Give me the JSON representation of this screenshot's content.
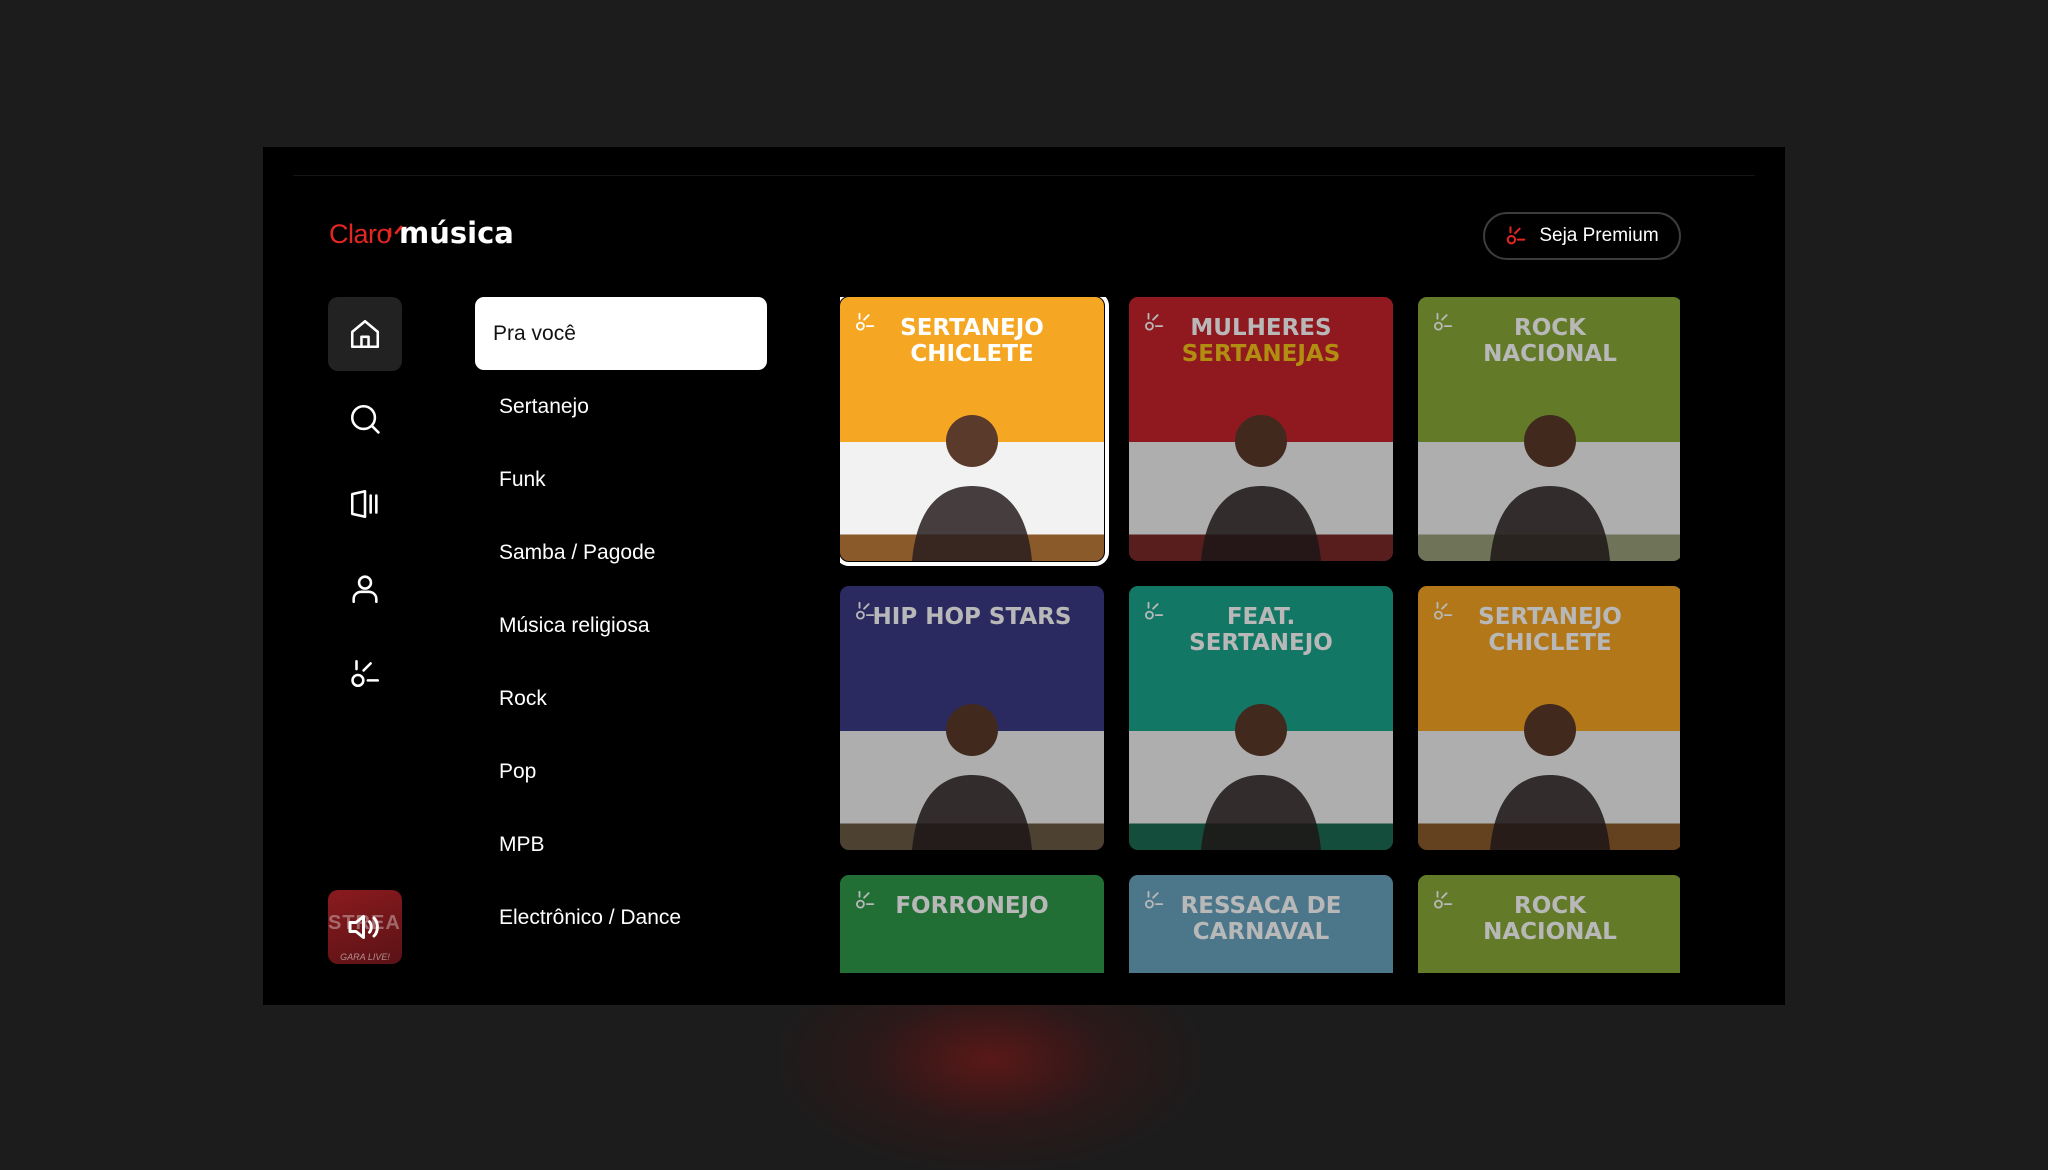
{
  "brand": {
    "logo_primary": "Claro",
    "logo_secondary": "música",
    "accent": "#e3261f"
  },
  "header": {
    "premium_label": "Seja Premium",
    "premium_icon": "claro-spark-icon"
  },
  "rail": {
    "items": [
      {
        "icon": "home-icon",
        "active": true
      },
      {
        "icon": "search-icon",
        "active": false
      },
      {
        "icon": "library-icon",
        "active": false
      },
      {
        "icon": "profile-icon",
        "active": false
      },
      {
        "icon": "claro-spark-icon",
        "active": false
      }
    ],
    "now_playing": {
      "icon": "volume-icon",
      "art_text": "STREAKS",
      "art_sub": "GARA LIVE!"
    }
  },
  "genres": [
    "Pra você",
    "Sertanejo",
    "Funk",
    "Samba / Pagode",
    "Música religiosa",
    "Rock",
    "Pop",
    "MPB",
    "Electrônico / Dance"
  ],
  "selected_genre": "Pra você",
  "playlists": [
    {
      "title": "SERTANEJO CHICLETE",
      "lines": [
        "SERTANEJO",
        "CHICLETE"
      ],
      "color": "#f5a623",
      "focused": true
    },
    {
      "title": "MULHERES SERTANEJAS",
      "lines": [
        "MULHERES",
        "SERTANEJAS"
      ],
      "color": "#c8232c",
      "focused": false
    },
    {
      "title": "ROCK NACIONAL",
      "lines": [
        "ROCK",
        "NACIONAL"
      ],
      "color": "#8aab3a",
      "focused": false
    },
    {
      "title": "HIP HOP STARS",
      "lines": [
        "HIP HOP STARS"
      ],
      "color": "#3b3b85",
      "focused": false
    },
    {
      "title": "FEAT. SERTANEJO",
      "lines": [
        "FEAT.",
        "SERTANEJO"
      ],
      "color": "#1aa58c",
      "focused": false
    },
    {
      "title": "SERTANEJO CHICLETE",
      "lines": [
        "SERTANEJO",
        "CHICLETE"
      ],
      "color": "#f5a623",
      "focused": false
    },
    {
      "title": "FORRONEJO",
      "lines": [
        "FORRONEJO"
      ],
      "color": "#2f9a4a",
      "focused": false
    },
    {
      "title": "RESSACA DE CARNAVAL",
      "lines": [
        "RESSACA DE",
        "CARNAVAL"
      ],
      "color": "#6aa5c0",
      "focused": false
    },
    {
      "title": "ROCK NACIONAL",
      "lines": [
        "ROCK",
        "NACIONAL"
      ],
      "color": "#8aab3a",
      "focused": false
    }
  ]
}
